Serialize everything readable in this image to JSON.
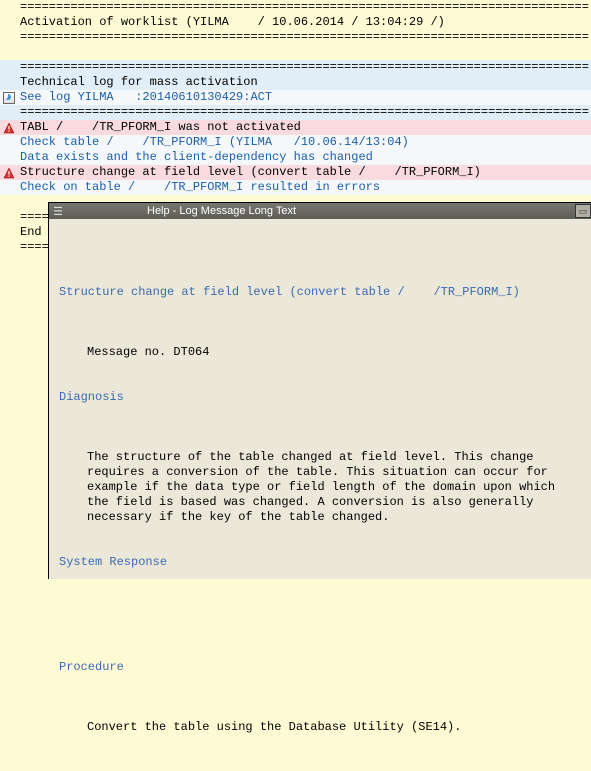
{
  "log": {
    "sep1": "===============================================================================",
    "activation": "Activation of worklist (YILMA    / 10.06.2014 / 13:04:29 /)",
    "sep2": "===============================================================================",
    "blank": "",
    "sep3": "===============================================================================",
    "techlog": "Technical log for mass activation",
    "seelog": "See log YILMA   :20140610130429:ACT",
    "sep4": "===============================================================================",
    "tabl_err": "TABL /    /TR_PFORM_I was not activated",
    "check_table": "Check table /    /TR_PFORM_I (YILMA   /10.06.14/13:04)",
    "data_exists": "Data exists and the client-dependency has changed",
    "struct_change": "Structure change at field level (convert table /    /TR_PFORM_I)",
    "check_errors": "Check on table /    /TR_PFORM_I resulted in errors",
    "sep5": "=====",
    "end": "End o",
    "sep6": "====="
  },
  "help": {
    "title": "Help - Log Message Long Text",
    "heading": "Structure change at field level (convert table /    /TR_PFORM_I)",
    "msgno": "Message no. DT064",
    "diag_h": "Diagnosis",
    "diag_t": "The structure of the table changed at field level. This change requires a conversion of the table. This situation can occur for example if the data type or field length of the domain upon which the field is based was changed. A conversion is also generally necessary if the key of the table changed.",
    "resp_h": "System Response",
    "proc_h": "Procedure",
    "proc_t": "Convert the table using the Database Utility (SE14)."
  }
}
